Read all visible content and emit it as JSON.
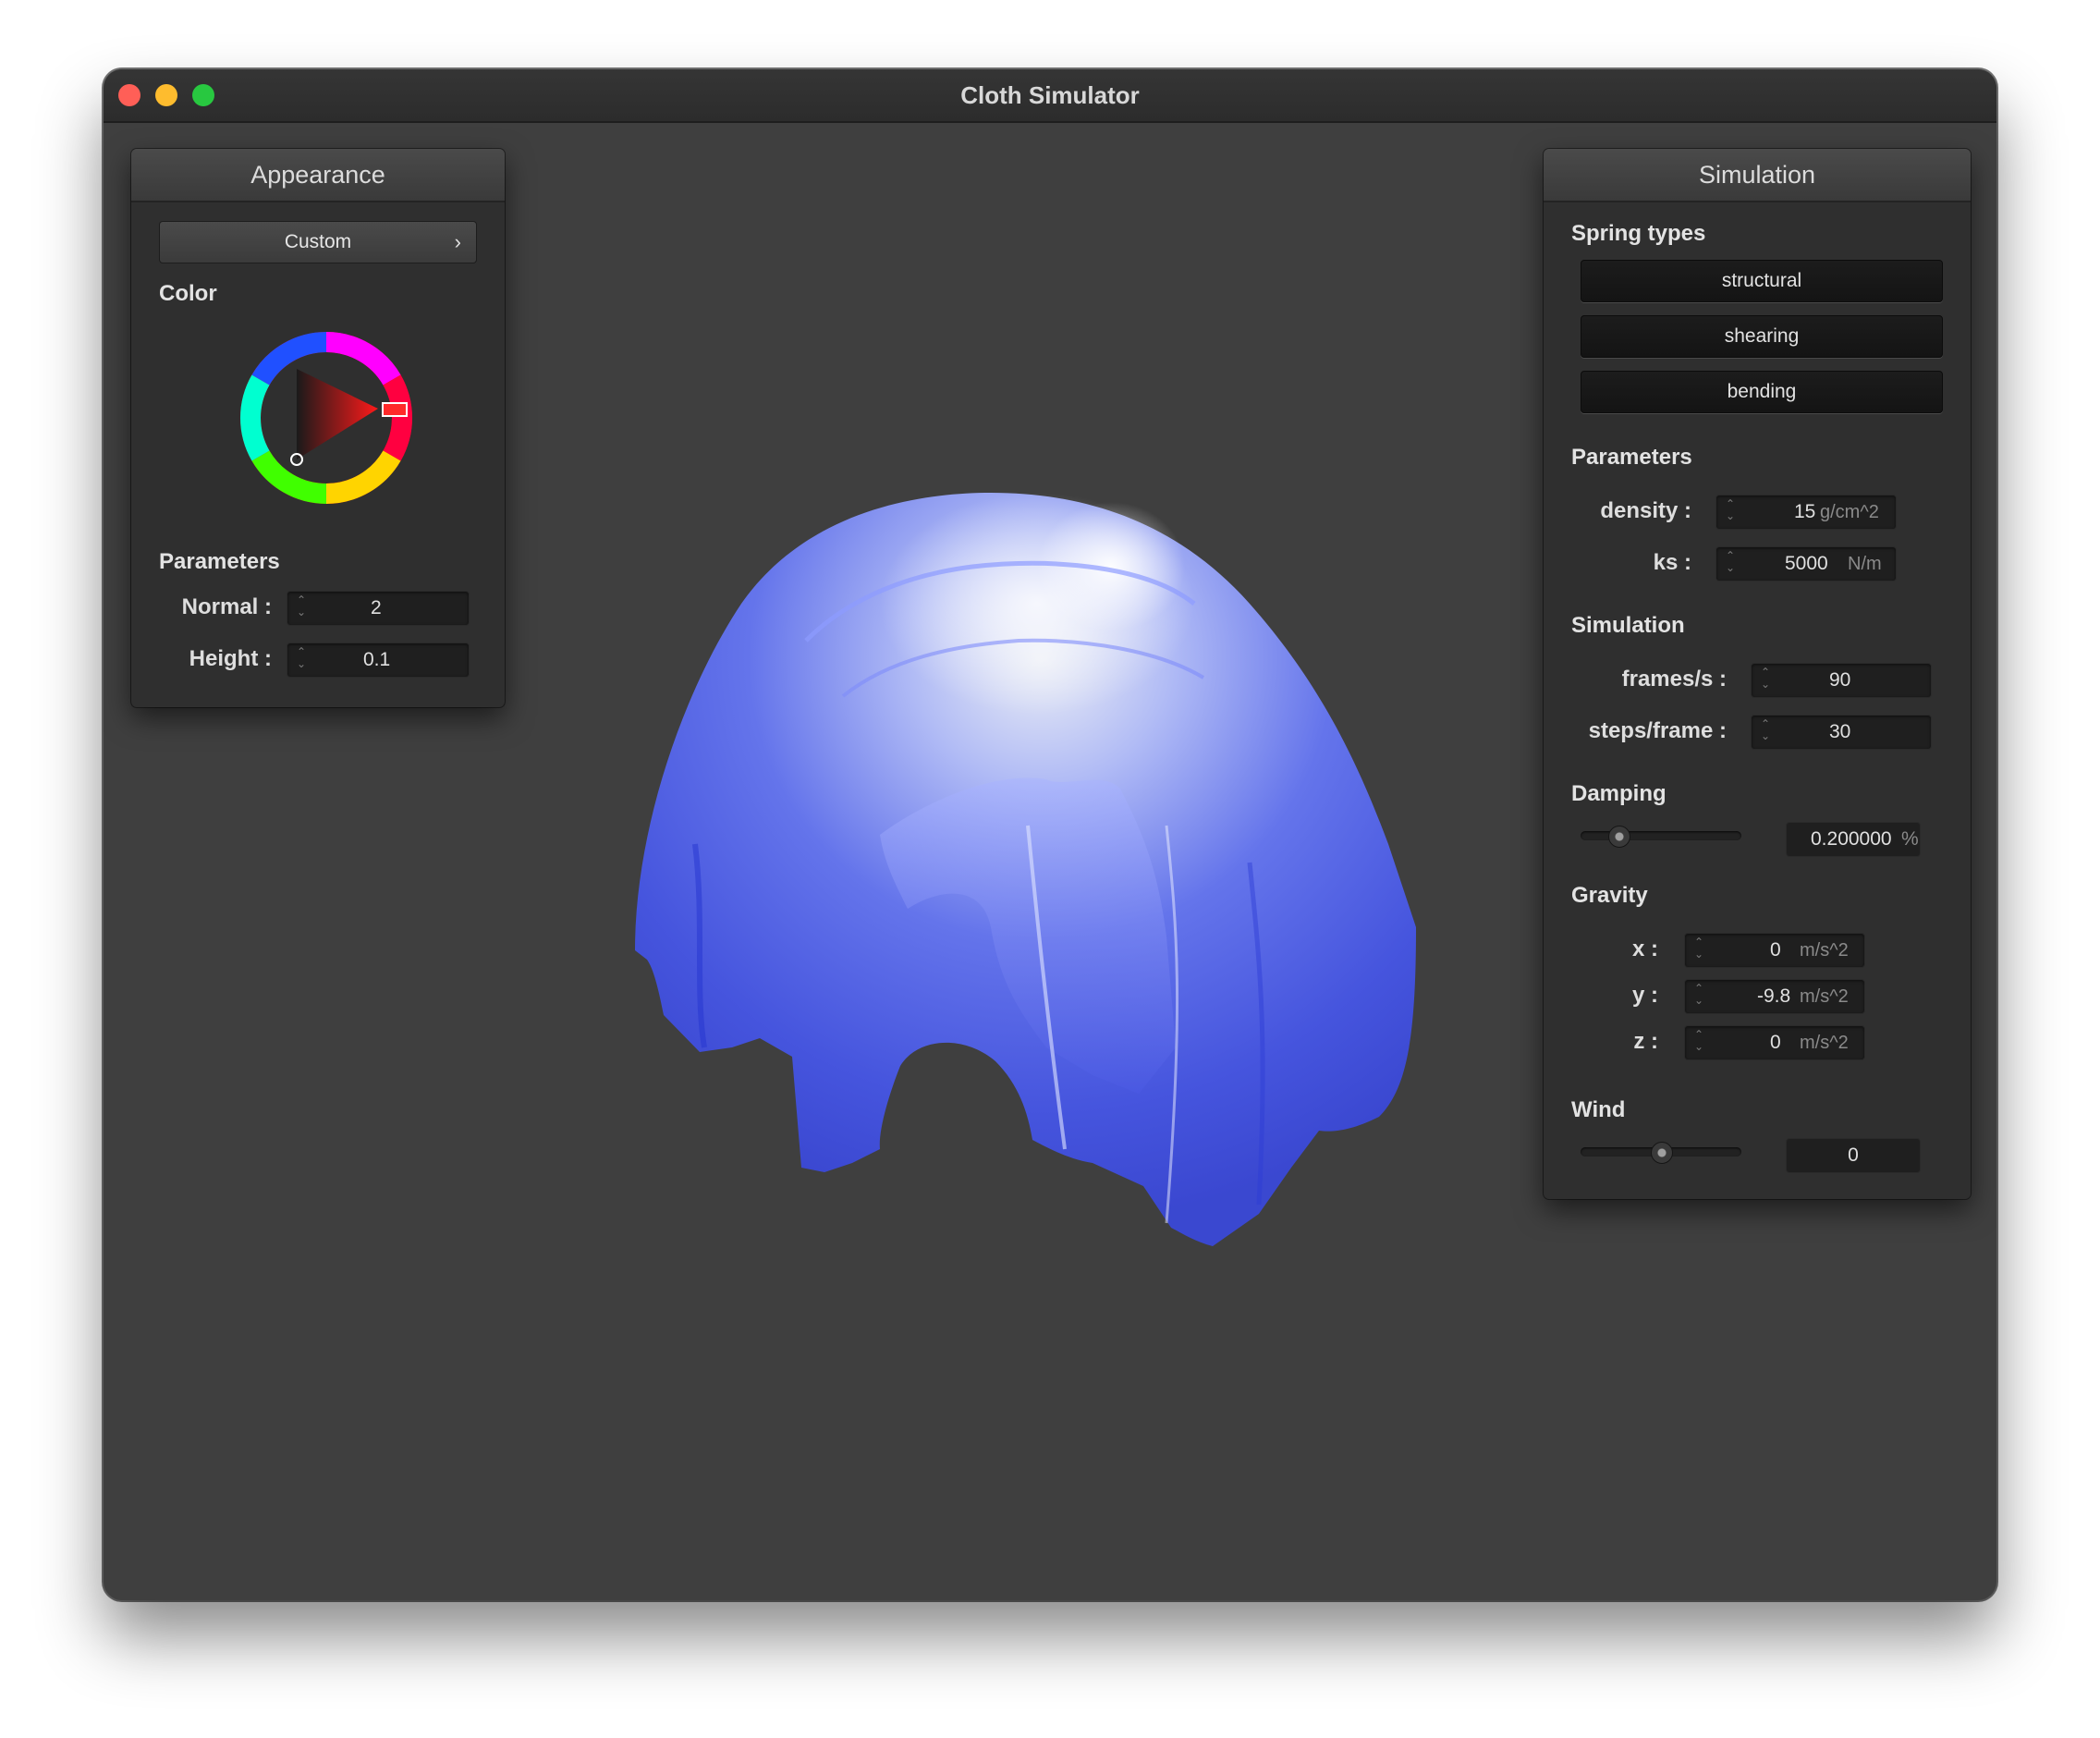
{
  "window": {
    "title": "Cloth Simulator"
  },
  "appearance": {
    "header": "Appearance",
    "preset": "Custom",
    "color_label": "Color",
    "selected_color": "#ff2a2a",
    "parameters_label": "Parameters",
    "normal": {
      "label": "Normal :",
      "value": "2"
    },
    "height": {
      "label": "Height :",
      "value": "0.1"
    }
  },
  "simulation_panel": {
    "header": "Simulation",
    "spring_types_label": "Spring types",
    "spring_types": [
      "structural",
      "shearing",
      "bending"
    ],
    "parameters_label": "Parameters",
    "density": {
      "label": "density :",
      "value": "15",
      "unit": "g/cm^2"
    },
    "ks": {
      "label": "ks :",
      "value": "5000",
      "unit": "N/m"
    },
    "simulation_label": "Simulation",
    "frames_per_s": {
      "label": "frames/s :",
      "value": "90"
    },
    "steps_per_frame": {
      "label": "steps/frame :",
      "value": "30"
    },
    "damping_label": "Damping",
    "damping": {
      "value": "0.200000",
      "unit": "%",
      "slider_fraction": 0.2
    },
    "gravity_label": "Gravity",
    "gravity": {
      "x": {
        "label": "x :",
        "value": "0",
        "unit": "m/s^2"
      },
      "y": {
        "label": "y :",
        "value": "-9.8",
        "unit": "m/s^2"
      },
      "z": {
        "label": "z :",
        "value": "0",
        "unit": "m/s^2"
      }
    },
    "wind_label": "Wind",
    "wind": {
      "value": "0",
      "slider_fraction": 0.5
    }
  },
  "colors": {
    "background": "#3f3f3f",
    "cloth": "#4a5cf0",
    "panel": "#2f2f2f"
  }
}
